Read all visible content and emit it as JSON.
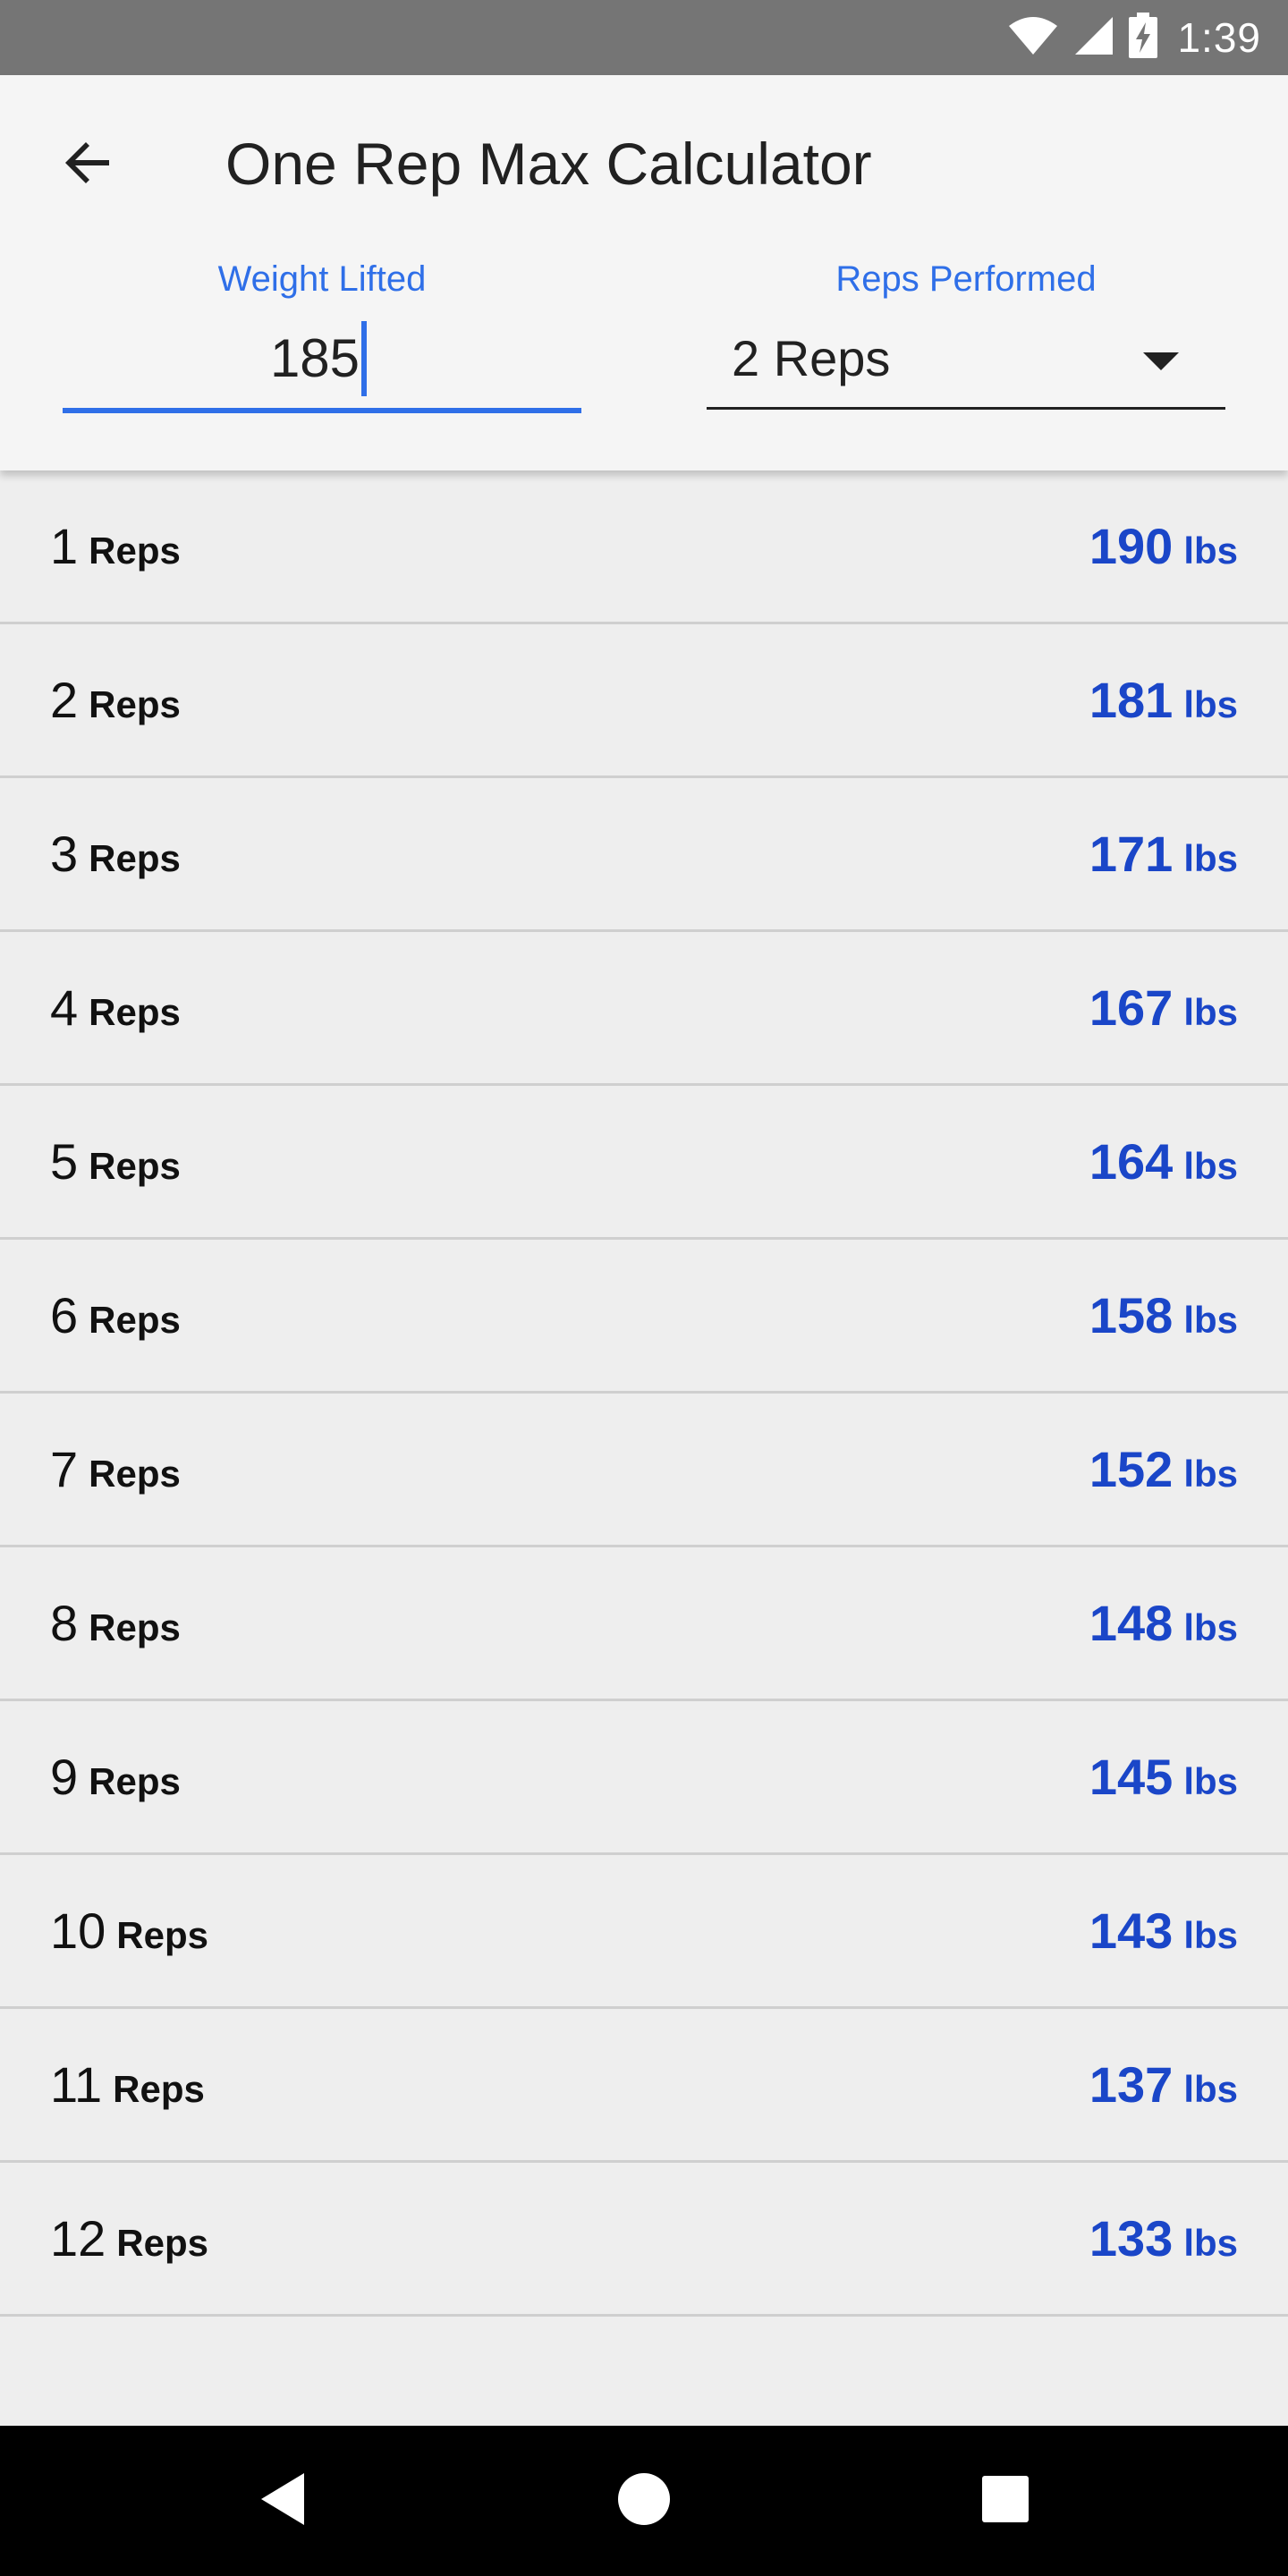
{
  "status_bar": {
    "time": "1:39",
    "icons": [
      "wifi-icon",
      "cellular-signal-icon",
      "battery-charging-icon"
    ]
  },
  "app_bar": {
    "title": "One Rep Max Calculator",
    "back_icon": "arrow-back-icon"
  },
  "form": {
    "weight_label": "Weight Lifted",
    "weight_value": "185",
    "reps_label": "Reps Performed",
    "reps_value": "2 Reps"
  },
  "results": [
    {
      "reps": "1",
      "reps_unit": "Reps",
      "weight": "190",
      "weight_unit": "lbs"
    },
    {
      "reps": "2",
      "reps_unit": "Reps",
      "weight": "181",
      "weight_unit": "lbs"
    },
    {
      "reps": "3",
      "reps_unit": "Reps",
      "weight": "171",
      "weight_unit": "lbs"
    },
    {
      "reps": "4",
      "reps_unit": "Reps",
      "weight": "167",
      "weight_unit": "lbs"
    },
    {
      "reps": "5",
      "reps_unit": "Reps",
      "weight": "164",
      "weight_unit": "lbs"
    },
    {
      "reps": "6",
      "reps_unit": "Reps",
      "weight": "158",
      "weight_unit": "lbs"
    },
    {
      "reps": "7",
      "reps_unit": "Reps",
      "weight": "152",
      "weight_unit": "lbs"
    },
    {
      "reps": "8",
      "reps_unit": "Reps",
      "weight": "148",
      "weight_unit": "lbs"
    },
    {
      "reps": "9",
      "reps_unit": "Reps",
      "weight": "145",
      "weight_unit": "lbs"
    },
    {
      "reps": "10",
      "reps_unit": "Reps",
      "weight": "143",
      "weight_unit": "lbs"
    },
    {
      "reps": "11",
      "reps_unit": "Reps",
      "weight": "137",
      "weight_unit": "lbs"
    },
    {
      "reps": "12",
      "reps_unit": "Reps",
      "weight": "133",
      "weight_unit": "lbs"
    }
  ],
  "colors": {
    "accent": "#2f6fe8",
    "result_value": "#1a46c8",
    "status_bar": "#757575",
    "background": "#eeeeee"
  },
  "nav_bar": {
    "icons": [
      "nav-back-icon",
      "nav-home-icon",
      "nav-recents-icon"
    ]
  }
}
